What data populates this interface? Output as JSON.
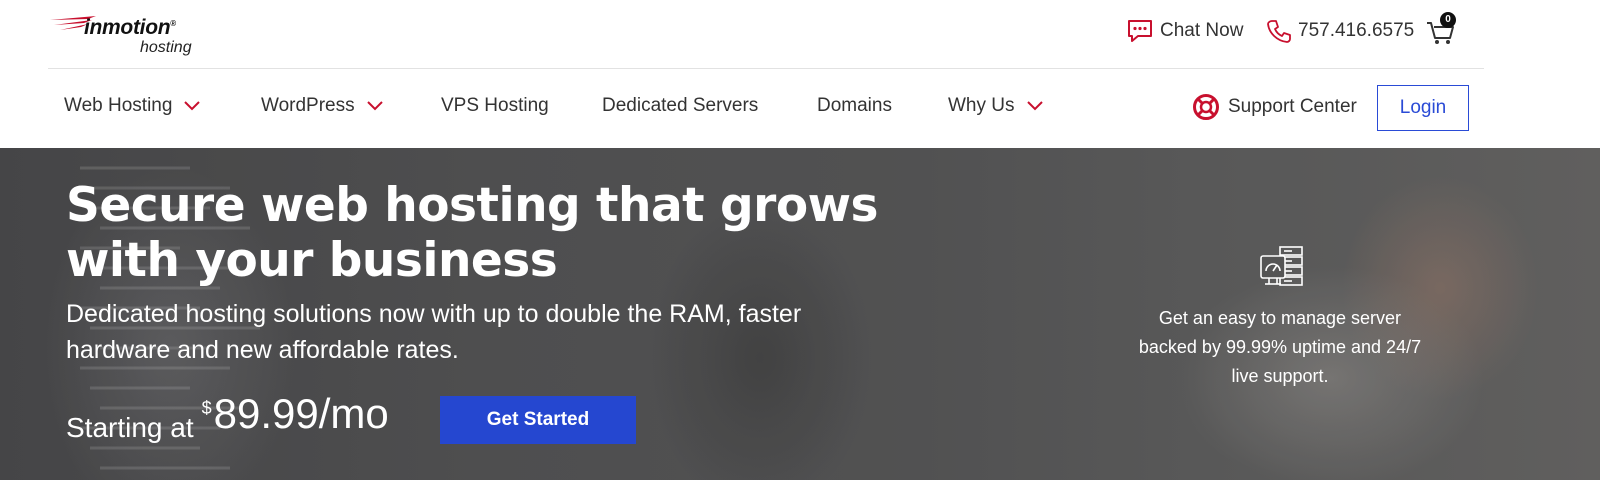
{
  "brand": {
    "logo_main": "inmotion",
    "logo_reg": "®",
    "logo_sub": "hosting"
  },
  "top_bar": {
    "chat_label": "Chat Now",
    "phone": "757.416.6575",
    "cart_count": "0"
  },
  "nav": {
    "items": [
      {
        "label": "Web Hosting",
        "has_dropdown": true
      },
      {
        "label": "WordPress",
        "has_dropdown": true
      },
      {
        "label": "VPS Hosting",
        "has_dropdown": false
      },
      {
        "label": "Dedicated Servers",
        "has_dropdown": false
      },
      {
        "label": "Domains",
        "has_dropdown": false
      },
      {
        "label": "Why Us",
        "has_dropdown": true
      }
    ],
    "support_label": "Support Center",
    "login_label": "Login"
  },
  "hero": {
    "title_line1": "Secure web hosting that grows",
    "title_line2": "with your business",
    "subtitle_line1": "Dedicated hosting solutions now with up to double the RAM, faster",
    "subtitle_line2": "hardware and new affordable rates.",
    "price_prefix": "Starting at",
    "price_currency": "$",
    "price_amount": "89.99/mo",
    "cta_label": "Get Started",
    "feature_line1": "Get an easy to manage server",
    "feature_line2": "backed by 99.99% uptime and 24/7",
    "feature_line3": "live support."
  },
  "colors": {
    "accent_red": "#c8102e",
    "primary_blue": "#2547d0",
    "text_dark": "#333333",
    "hero_bg": "#555555"
  },
  "icons": {
    "chat": "chat-bubble-icon",
    "phone": "phone-icon",
    "cart": "cart-icon",
    "support": "lifebuoy-icon",
    "dropdown": "chevron-down-icon",
    "feature": "server-dashboard-icon"
  }
}
